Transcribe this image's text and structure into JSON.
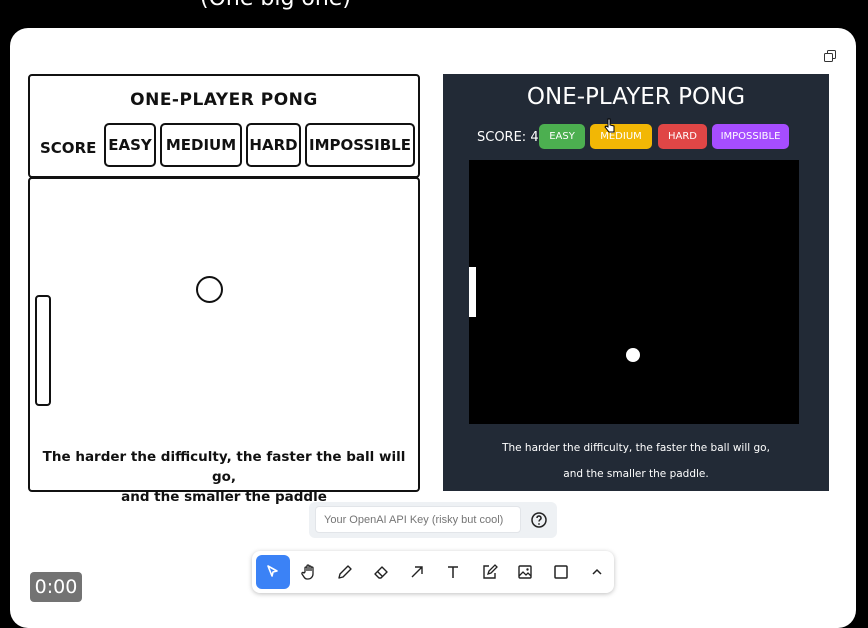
{
  "header": {
    "title": "(One big one)"
  },
  "sketch": {
    "title": "ONE-PLAYER PONG",
    "score_label": "SCORE",
    "buttons": [
      "EASY",
      "MEDIUM",
      "HARD",
      "IMPOSSIBLE"
    ],
    "caption_line1": "The harder the difficulty, the faster the ball will go,",
    "caption_line2": "and the smaller the paddle"
  },
  "app": {
    "title": "ONE-PLAYER PONG",
    "score": "SCORE: 4",
    "buttons": [
      {
        "label": "EASY",
        "color": "#4caf50"
      },
      {
        "label": "MEDIUM",
        "color": "#f2b705"
      },
      {
        "label": "HARD",
        "color": "#e04646"
      },
      {
        "label": "IMPOSSIBLE",
        "color": "#a64dff"
      }
    ],
    "caption_line1": "The harder the difficulty, the faster the ball will go,",
    "caption_line2": "and the smaller the paddle."
  },
  "api": {
    "placeholder": "Your OpenAI API Key (risky but cool)"
  },
  "toolbar": {
    "tools": [
      "select-tool",
      "hand-tool",
      "pencil-tool",
      "eraser-tool",
      "arrow-tool",
      "text-tool",
      "note-tool",
      "image-tool",
      "rectangle-tool",
      "expand-tool"
    ],
    "active_color": "#3b82f6"
  },
  "video": {
    "timer": "0:00"
  }
}
